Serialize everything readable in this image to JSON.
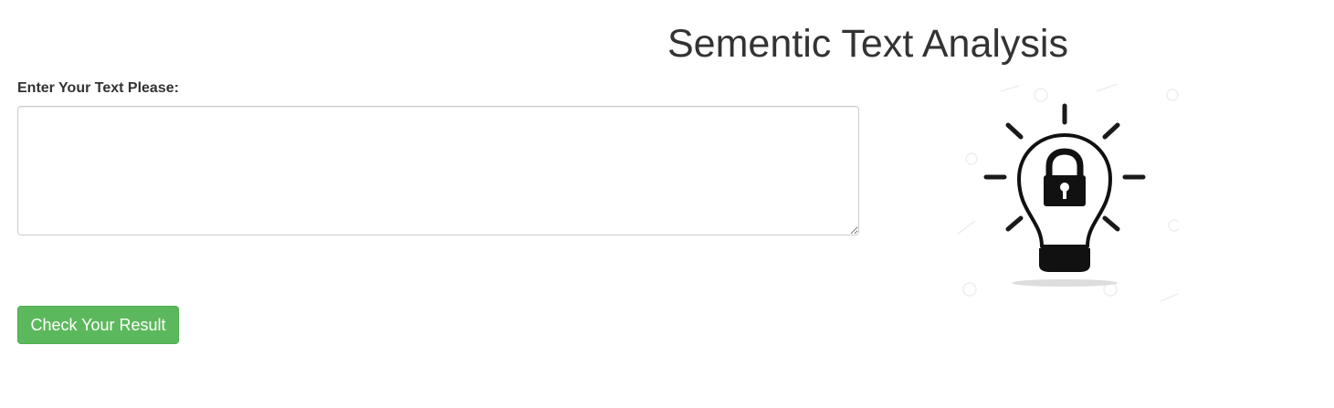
{
  "header": {
    "title": "Sementic Text Analysis"
  },
  "form": {
    "label": "Enter Your Text Please:",
    "textarea_value": "",
    "textarea_placeholder": "",
    "submit_label": "Check Your Result"
  },
  "illustration": {
    "icon": "lightbulb-lock-icon"
  },
  "colors": {
    "button_bg": "#5cb85c",
    "button_border": "#4cae4c",
    "text": "#333333"
  }
}
